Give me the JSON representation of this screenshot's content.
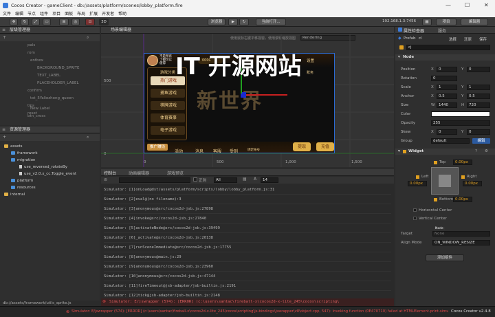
{
  "window": {
    "title": "Cocos Creator - gameClient - db://assets/platform/scenes/lobby_platform.fire",
    "minimize": "—",
    "maximize": "☐",
    "close": "✕"
  },
  "menu": [
    "文件",
    "编辑",
    "节点",
    "组件",
    "项目",
    "面板",
    "布局",
    "扩展",
    "开发者",
    "帮助"
  ],
  "toolbar": {
    "preview_mode": "浏览器",
    "play": "▶",
    "refresh": "↻",
    "scene_dropdown": "当前打开...",
    "ip": "192.168.1.3:7456",
    "project_btn": "项目",
    "editor_btn": "编辑器",
    "mode_3d": "3D"
  },
  "hierarchy": {
    "title": "层级管理器",
    "items": [
      "pals",
      "rom",
      "entbox",
      "BACKGROUND_SPRITE",
      "TEXT_LABEL",
      "PLACEHOLDER_LABEL",
      "confirm",
      "txt_5Yaliezhong_queen",
      "tips",
      "reset",
      "New Label",
      "btn_cross"
    ]
  },
  "assets": {
    "title": "资源管理器",
    "items": [
      {
        "name": "assets",
        "type": "folder"
      },
      {
        "name": "framework",
        "type": "folder-blue"
      },
      {
        "name": "migration",
        "type": "folder-blue"
      },
      {
        "name": "use_reversed_rotateBy",
        "type": "file"
      },
      {
        "name": "use_v2.0.x_cc.Toggle_event",
        "type": "file"
      },
      {
        "name": "platform",
        "type": "folder-blue"
      },
      {
        "name": "resources",
        "type": "folder-blue"
      },
      {
        "name": "internal",
        "type": "folder"
      }
    ],
    "path": "db://assets/framework/utils_sprite.js"
  },
  "scene": {
    "title": "场景编辑器",
    "hint": "使用鼠标右键平移视窗，使用滚轮缩放视图",
    "rendering": "Rendering",
    "axis_500": "500",
    "axis_0": "0",
    "ruler": [
      "0",
      "500",
      "1,000",
      "1,500"
    ],
    "watermark": "IT 开源网站",
    "game": {
      "logo_text": "不是所有\n了都可以\n值得",
      "score": "000C",
      "category_title": "游戏分类",
      "categories": [
        "热门游戏",
        "捕鱼游戏",
        "棋牌游戏",
        "体育赛事",
        "电子游戏"
      ],
      "bottom": [
        "推广赚钱",
        "活动",
        "消息",
        "客服",
        "受到"
      ],
      "settings": "设置",
      "records": "账务",
      "center_title": "新世界",
      "withdraw": "提现",
      "recharge": "充值",
      "app_label": "绑定帐号"
    }
  },
  "console": {
    "tabs": [
      "控制台",
      "动画编辑器",
      "游戏预览"
    ],
    "regex_label": "正则",
    "filter": "All",
    "font_size": "14",
    "lines": [
      "Simulator: [1]onLoad@dst/assets/platform/scripts/lobby/lobby_platform.js:31",
      "Simulator: [2]eval@(no filename):3",
      "Simulator: [3]anonymous@src/cocos2d-jsb.js:27898",
      "Simulator: [4]invoke@src/cocos2d-jsb.js:27840",
      "Simulator: [5]activateNode@src/cocos2d-jsb.js:39499",
      "Simulator: [6]_activate@src/cocos2d-jsb.js:20138",
      "Simulator: [7]runSceneImmediate@src/cocos2d-jsb.js:17755",
      "Simulator: [8]anonymous@main.js:29",
      "Simulator: [9]anonymous@src/cocos2d-jsb.js:23960",
      "Simulator: [10]anonymous@src/cocos2d-jsb.js:47144",
      "Simulator: [11]fireTimeout@jsb-adapter/jsb-builtin.js:2191",
      "Simulator: [12]tick@jsb-adapter/jsb-builtin.js:2148"
    ],
    "error_line": "Simulator: E/jswrapper (574): [ERROR] (c:\\users\\santac\\fireball-x\\cocos2d-x-lite_245\\cocos\\scripting\\"
  },
  "inspector": {
    "tab1": "属性检查器",
    "tab2": "服务",
    "prefab_label": "Prefab",
    "prefab_value": "cl",
    "actions": [
      "选择",
      "还原",
      "保存"
    ],
    "node_name": "cj",
    "section_node": "Node",
    "position": {
      "label": "Position",
      "x": "0",
      "y": "0"
    },
    "rotation": {
      "label": "Rotation",
      "value": "0"
    },
    "scale": {
      "label": "Scale",
      "x": "1",
      "y": "1"
    },
    "anchor": {
      "label": "Anchor",
      "x": "0.5",
      "y": "0.5"
    },
    "size": {
      "label": "Size",
      "w": "1440",
      "h": "720"
    },
    "color": {
      "label": "Color"
    },
    "opacity": {
      "label": "Opacity",
      "value": "255"
    },
    "skew": {
      "label": "Skew",
      "x": "0",
      "y": "0"
    },
    "group": {
      "label": "Group",
      "value": "default",
      "edit": "编辑"
    },
    "widget": {
      "title": "Widget",
      "top": "Top",
      "top_val": "0.00px",
      "left": "Left",
      "left_val": "0.00px",
      "right": "Right",
      "right_val": "0.00px",
      "bottom": "Bottom",
      "bottom_val": "0.00px",
      "hcenter": "Horizontal Center",
      "vcenter": "Vertical Center",
      "target": "Target",
      "target_val": "None",
      "target_badge": "Node",
      "align": "Align Mode",
      "align_val": "ON_WINDOW_RESIZE"
    },
    "add_component": "添加组件"
  },
  "status": {
    "error": "Simulator: E/jswrapper (574): [ERROR] (c:\\users\\santac\\fireball-x\\cocos2d-x-lite_245\\cocos\\scripting\\js-bindings\\jswrapper\\v8\\object.cpp, 547): Invoking function (0E470710) failed at HTMLElement.print-simulator-log",
    "version": "Cocos Creator v2.4.8"
  },
  "colors": {
    "accent": "#3a7ad9",
    "error": "#e04848",
    "selection": "#2b5aa0"
  }
}
